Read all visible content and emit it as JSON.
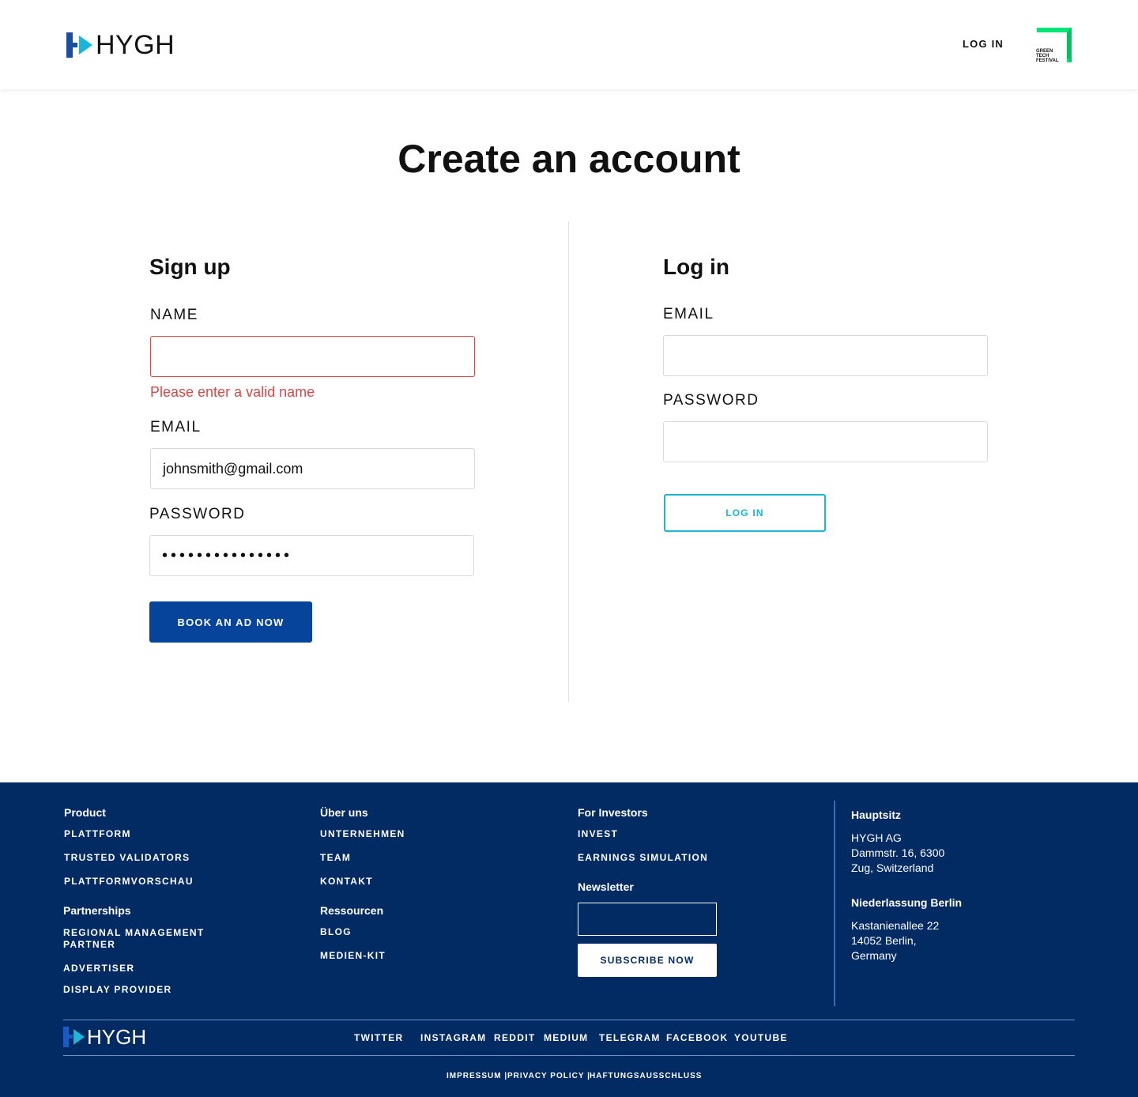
{
  "header": {
    "brand": "HYGH",
    "login_label": "LOG IN",
    "partner_logo_text": [
      "GREEN",
      "TECH",
      "FESTIVAL"
    ]
  },
  "page": {
    "title": "Create an account"
  },
  "signup": {
    "title": "Sign up",
    "name_label": "NAME",
    "name_value": "",
    "name_error": "Please enter a valid name",
    "email_label": "EMAIL",
    "email_value": "johnsmith@gmail.com",
    "password_label": "PASSWORD",
    "password_value": "•••••••••••••••",
    "submit_label": "BOOK AN AD NOW"
  },
  "login": {
    "title": "Log in",
    "email_label": "EMAIL",
    "email_value": "",
    "password_label": "PASSWORD",
    "password_value": "",
    "submit_label": "LOG IN"
  },
  "footer": {
    "product": {
      "title": "Product",
      "links": [
        "PLATTFORM",
        "TRUSTED VALIDATORS",
        "PLATTFORMVORSCHAU"
      ]
    },
    "partnerships": {
      "title": "Partnerships",
      "links": [
        "REGIONAL MANAGEMENT PARTNER",
        "ADVERTISER",
        "DISPLAY PROVIDER"
      ]
    },
    "about": {
      "title": "Über uns",
      "links": [
        "UNTERNEHMEN",
        "TEAM",
        "KONTAKT"
      ]
    },
    "resources": {
      "title": "Ressourcen",
      "links": [
        "BLOG",
        "MEDIEN-KIT"
      ]
    },
    "investors": {
      "title": "For Investors",
      "links": [
        "INVEST",
        "EARNINGS SIMULATION"
      ]
    },
    "newsletter": {
      "title": "Newsletter",
      "input_value": "",
      "button_label": "SUBSCRIBE NOW"
    },
    "hq": {
      "title": "Hauptsitz",
      "lines": [
        "HYGH AG",
        "Dammstr. 16, 6300",
        "Zug, Switzerland"
      ]
    },
    "berlin": {
      "title": "Niederlassung Berlin",
      "lines": [
        "Kastanienallee 22",
        "14052 Berlin,",
        "Germany"
      ]
    },
    "brand": "HYGH",
    "social": [
      "TWITTER",
      "INSTAGRAM",
      "REDDIT",
      "MEDIUM",
      "TELEGRAM",
      "FACEBOOK",
      "YOUTUBE"
    ],
    "legal": [
      "IMPRESSUM |",
      "PRIVACY POLICY |",
      "HAFTUNGSAUSSCHLUSS"
    ]
  },
  "colors": {
    "brand_blue": "#06439a",
    "footer_navy": "#022b64",
    "accent_cyan": "#1cb4d7",
    "error_red": "#d94848",
    "partner_green": "#00e676"
  }
}
